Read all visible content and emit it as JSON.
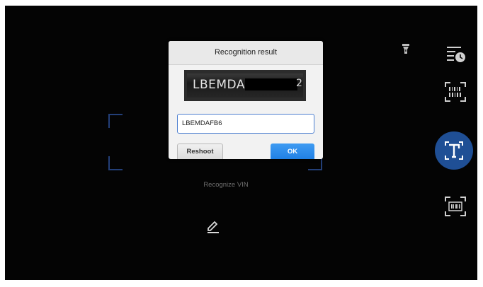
{
  "camera": {
    "hint": "Recognize VIN",
    "icons": {
      "flash": "flashlight-icon",
      "history": "history-icon",
      "barcode": "barcode-scan-icon",
      "text_mode": "text-recognition-icon",
      "scan": "qr-scan-icon",
      "edit": "edit-pencil-icon"
    },
    "accent": "#1f4f95"
  },
  "dialog": {
    "title": "Recognition result",
    "image_text": "LBEMDAFB",
    "image_trailing": "2",
    "input_value": "LBEMDAFB6",
    "reshoot_label": "Reshoot",
    "ok_label": "OK",
    "ok_color": "#2a8cee"
  }
}
